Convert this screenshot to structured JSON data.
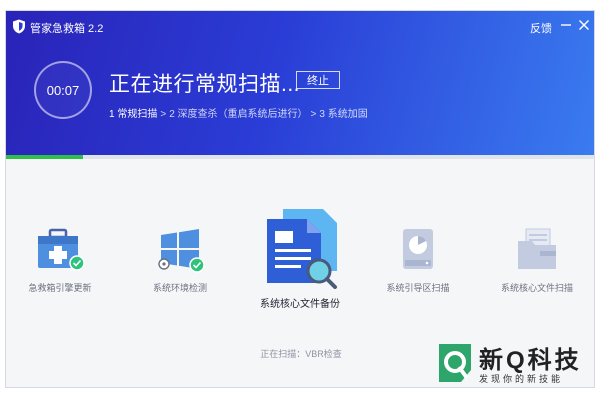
{
  "window": {
    "title": "管家急救箱 2.2",
    "feedback_label": "反馈"
  },
  "scan": {
    "timer": "00:07",
    "title": "正在进行常规扫描...",
    "stop_label": "终止",
    "progress": 0.13,
    "steps": [
      "1 常规扫描",
      "2 深度查杀（重启系统后进行）",
      "3 系统加固"
    ],
    "status": "正在扫描：VBR检查"
  },
  "items": [
    {
      "label": "急救箱引擎更新",
      "icon": "medical-kit-icon"
    },
    {
      "label": "系统环境检测",
      "icon": "windows-gear-icon"
    },
    {
      "label": "系统核心文件备份",
      "icon": "document-search-icon"
    },
    {
      "label": "系统引导区扫描",
      "icon": "hard-drive-icon"
    },
    {
      "label": "系统核心文件扫描",
      "icon": "folder-files-icon"
    }
  ],
  "watermark": {
    "title": "新Q科技",
    "subtitle": "发现你的新技能"
  },
  "colors": {
    "header_start": "#2a23b8",
    "header_end": "#3a7cf0",
    "progress": "#30c04a",
    "check": "#2ec37a"
  }
}
